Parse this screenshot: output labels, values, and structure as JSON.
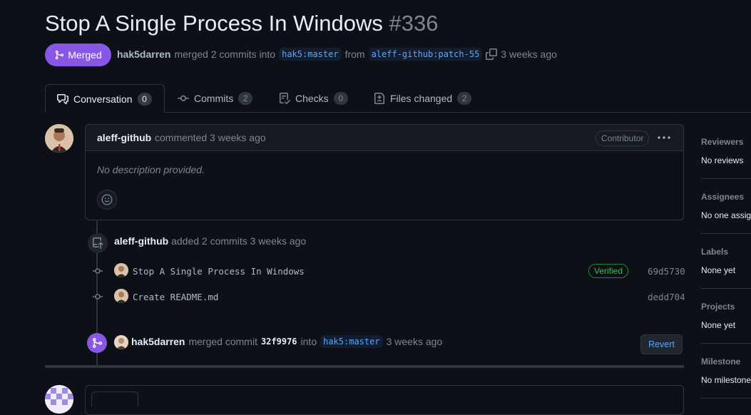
{
  "pr": {
    "title": "Stop A Single Process In Windows",
    "number": "#336",
    "state": "Merged",
    "author": "hak5darren",
    "merge_text": "merged 2 commits into",
    "base_branch": "hak5:master",
    "from_text": "from",
    "head_branch": "aleff-github:patch-55",
    "time": "3 weeks ago"
  },
  "tabs": [
    {
      "label": "Conversation",
      "count": "0",
      "icon": "comment-discussion-icon"
    },
    {
      "label": "Commits",
      "count": "2",
      "icon": "git-commit-icon"
    },
    {
      "label": "Checks",
      "count": "0",
      "icon": "checklist-icon"
    },
    {
      "label": "Files changed",
      "count": "2",
      "icon": "file-diff-icon"
    }
  ],
  "comment": {
    "author": "aleff-github",
    "action": "commented 3 weeks ago",
    "badge": "Contributor",
    "body": "No description provided."
  },
  "commits_event": {
    "author": "aleff-github",
    "action": "added 2 commits 3 weeks ago",
    "commits": [
      {
        "message": "Stop A Single Process In Windows",
        "verified": "Verified",
        "sha": "69d5730"
      },
      {
        "message": "Create README.md",
        "sha": "dedd704"
      }
    ]
  },
  "merge_event": {
    "author": "hak5darren",
    "action": "merged commit",
    "sha": "32f9976",
    "into": "into",
    "branch": "hak5:master",
    "time": "3 weeks ago",
    "revert_label": "Revert"
  },
  "sidebar": [
    {
      "heading": "Reviewers",
      "value": "No reviews"
    },
    {
      "heading": "Assignees",
      "value": "No one assigned"
    },
    {
      "heading": "Labels",
      "value": "None yet"
    },
    {
      "heading": "Projects",
      "value": "None yet"
    },
    {
      "heading": "Milestone",
      "value": "No milestone"
    }
  ],
  "colors": {
    "background": "#0d1117",
    "merged": "#8957e5",
    "link": "#58a6ff",
    "verified": "#3fb950",
    "border": "#30363d"
  }
}
